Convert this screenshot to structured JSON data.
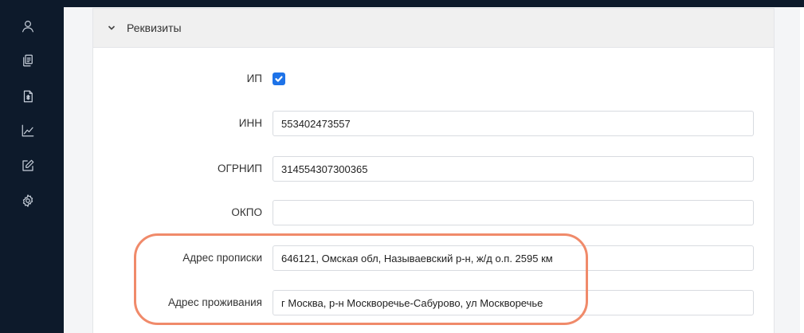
{
  "sidebar": {
    "icons": [
      "user-icon",
      "documents-icon",
      "invoice-icon",
      "chart-icon",
      "edit-icon",
      "gear-icon"
    ]
  },
  "panel": {
    "title": "Реквизиты",
    "collapse_icon": "chevron-down-icon"
  },
  "form": {
    "ip_label": "ИП",
    "ip_checked": true,
    "inn_label": "ИНН",
    "inn_value": "553402473557",
    "ogrnip_label": "ОГРНИП",
    "ogrnip_value": "314554307300365",
    "okpo_label": "ОКПО",
    "okpo_value": "",
    "reg_address_label": "Адрес прописки",
    "reg_address_value": "646121, Омская обл, Называевский р-н, ж/д о.п. 2595 км",
    "live_address_label": "Адрес проживания",
    "live_address_value": "г Москва, р-н Москворечье-Сабурово, ул Москворечье"
  },
  "colors": {
    "sidebar_bg": "#0d1a2b",
    "checkbox_accent": "#1e73e8",
    "highlight_outline": "#f08a6a"
  }
}
